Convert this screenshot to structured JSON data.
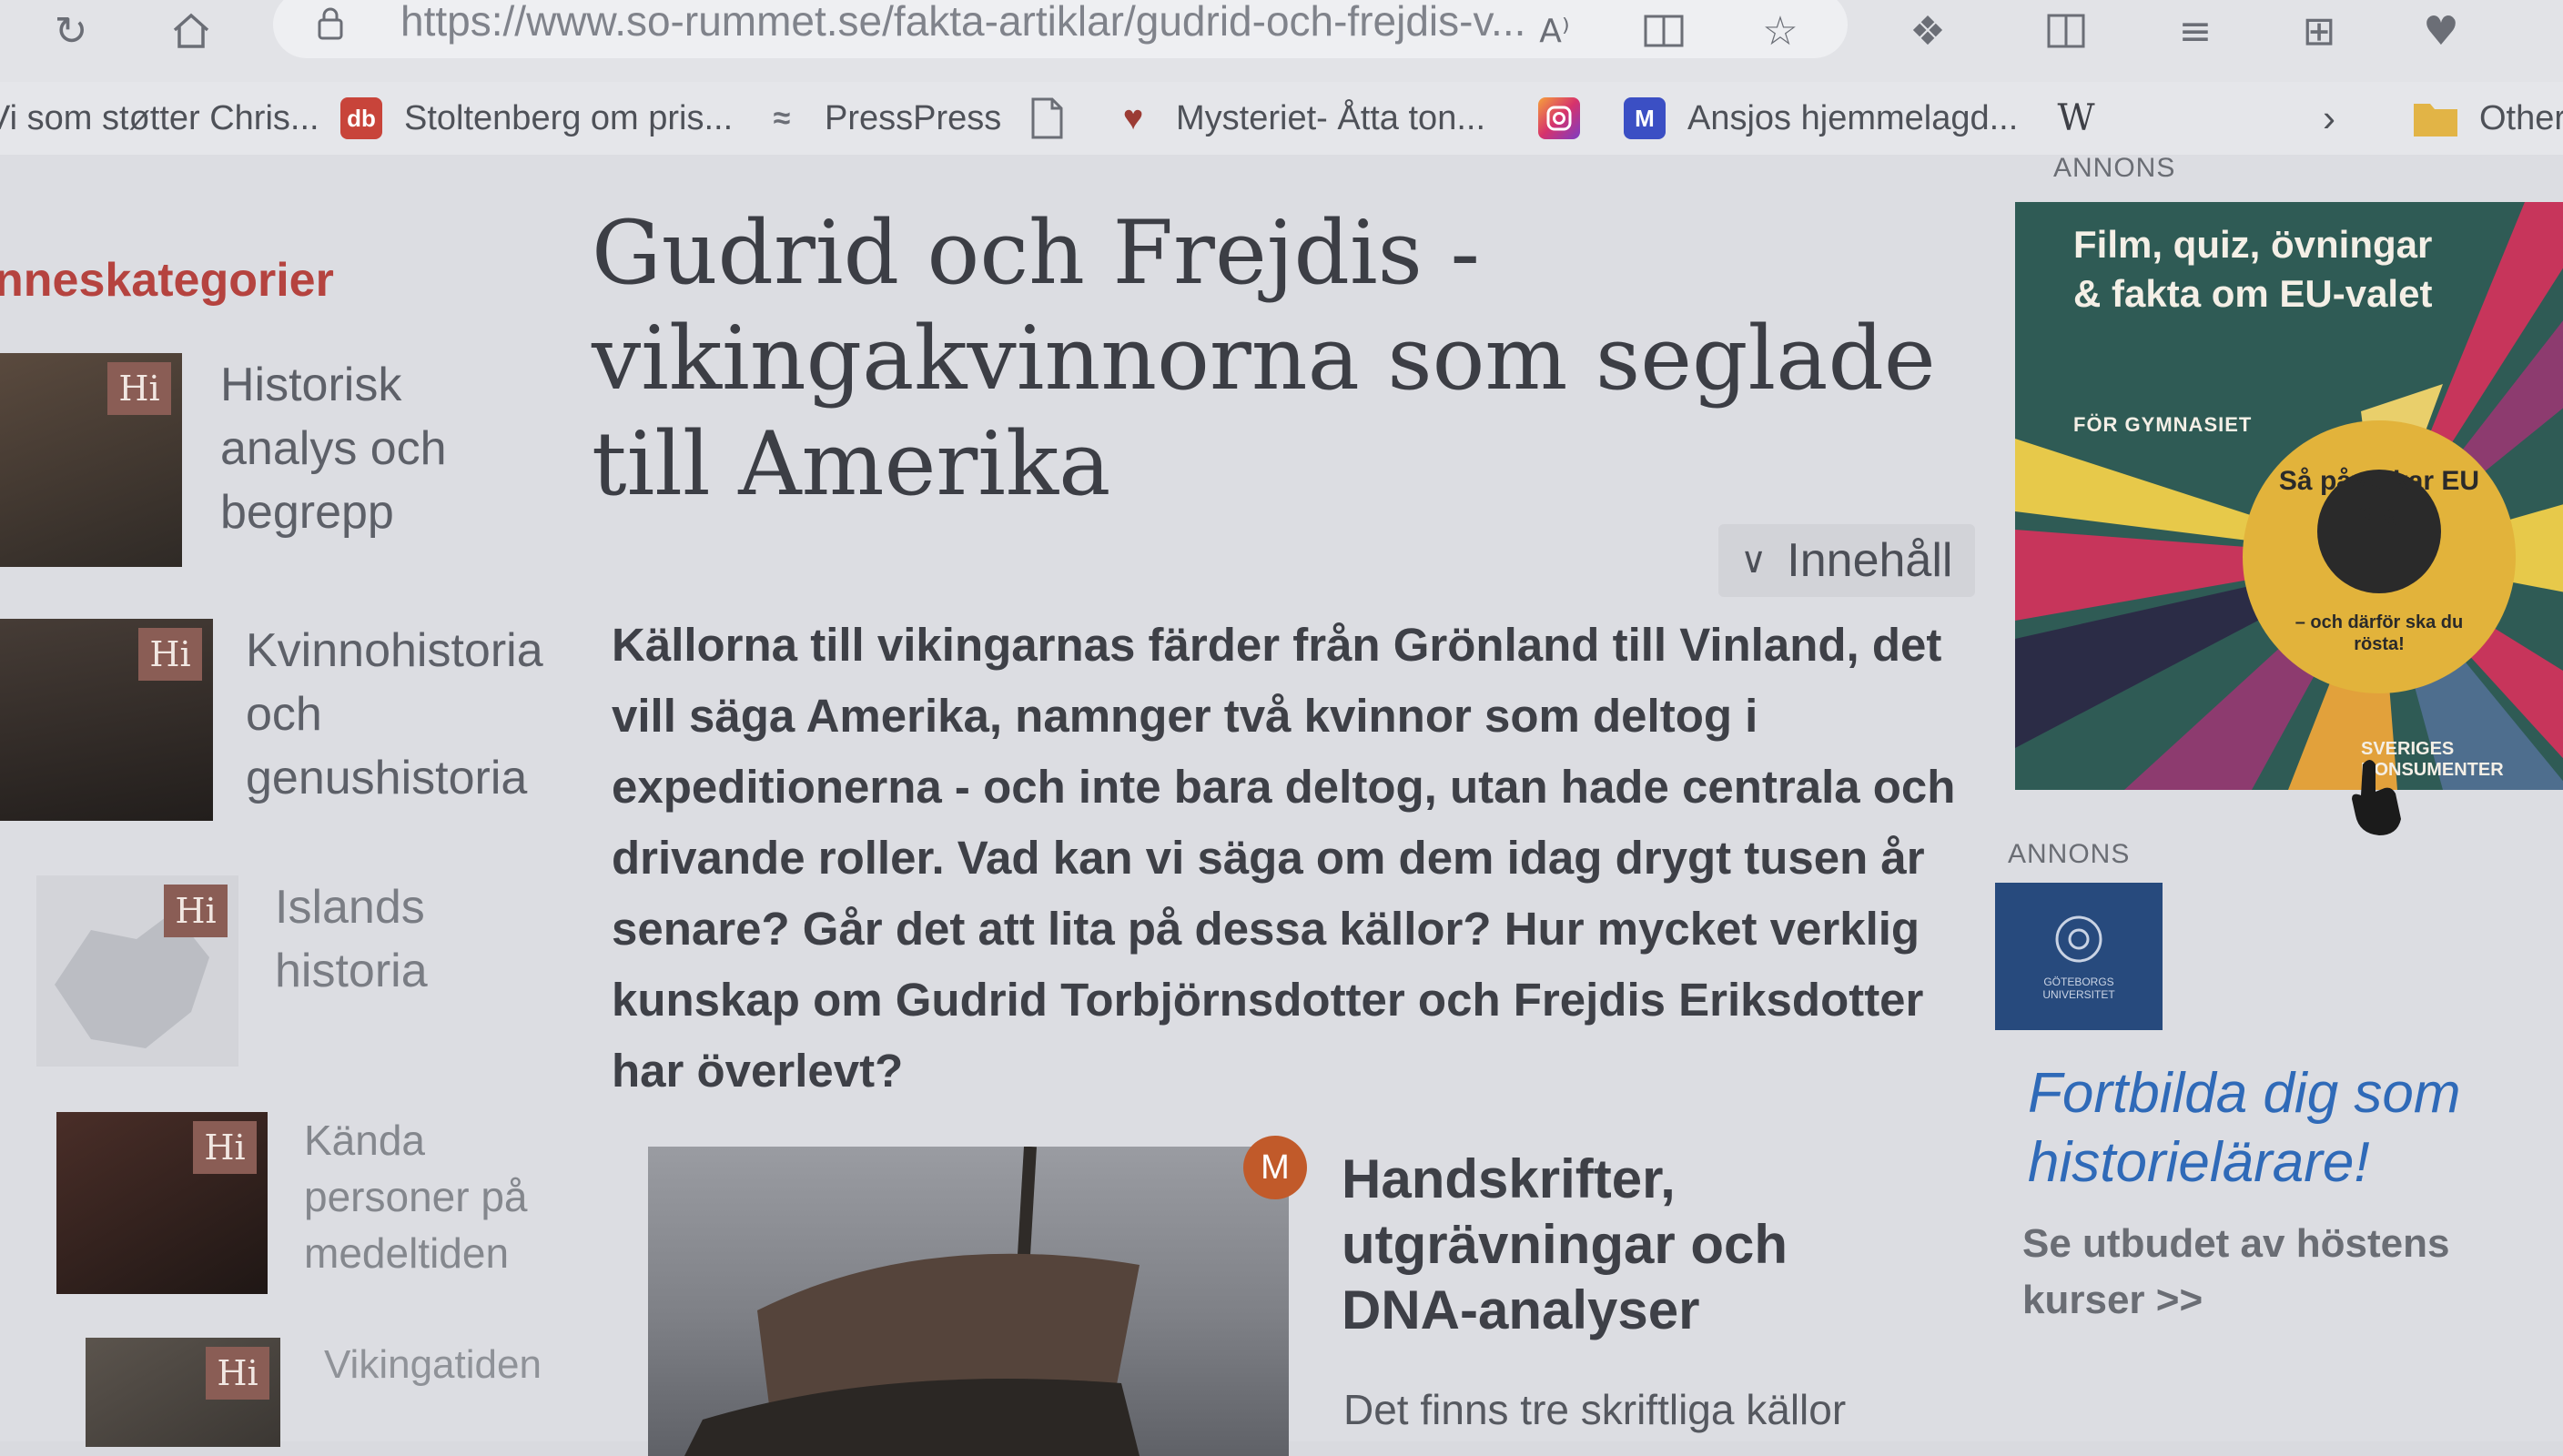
{
  "browser": {
    "url": "https://www.so-rummet.se/fakta-artiklar/gudrid-och-frejdis-v...",
    "read_aloud_label": "A⁾",
    "bookmarks": [
      {
        "label": "Vi som støtter Chris..."
      },
      {
        "label": "Stoltenberg om pris...",
        "favicon_text": "db",
        "favicon_color": "#c8443a"
      },
      {
        "label": "PressPress"
      },
      {
        "label": ""
      },
      {
        "label": "Mysteriet- Åtta ton..."
      },
      {
        "label": "",
        "favicon_color": "#d6336c"
      },
      {
        "label": "Ansjos hjemmelagd...",
        "favicon_text": "M",
        "favicon_color": "#3b4fc4"
      },
      {
        "label": "",
        "favicon_text": "W"
      }
    ],
    "other_favorites_label": "Other"
  },
  "sidebar": {
    "heading": "nneskategorier",
    "badge_text": "Hi",
    "categories": [
      {
        "label": "Historisk analys och begrepp"
      },
      {
        "label": "Kvinnohistoria och genushistoria"
      },
      {
        "label": "Islands historia"
      },
      {
        "label": "Kända personer på medeltiden"
      },
      {
        "label": "Vikingatiden"
      }
    ]
  },
  "article": {
    "title": "Gudrid och Frejdis - vikingakvinnorna som seglade till Amerika",
    "toc_label": "Innehåll",
    "lead": "Källorna till vikingarnas färder från Grönland till Vinland, det vill säga Amerika, namnger två kvinnor som deltog i expeditionerna - och inte bara deltog, utan hade centrala och drivande roller. Vad kan vi säga om dem idag drygt tusen år senare? Går det att lita på dessa källor? Hur mycket verklig kunskap om Gudrid Torbjörnsdotter och Frejdis Eriksdotter har överlevt?",
    "card": {
      "badge": "M",
      "title": "Handskrifter, utgrävningar och DNA-analyser",
      "text": "Det finns tre skriftliga källor"
    }
  },
  "ads": {
    "label_top": "ANNONS",
    "banner": {
      "text": "Film, quiz, övningar & fakta om EU-valet",
      "sub": "FÖR GYMNASIET",
      "circle_text": "Så påverkar EU dig",
      "circle_sub": "– och därför ska du rösta!",
      "brand": "SVERIGES KONSUMENTER"
    },
    "label_bottom": "ANNONS",
    "uni_logo_text": "GÖTEBORGS UNIVERSITET",
    "link": "Fortbilda dig som historielärare!",
    "more": "Se utbudet av höstens kurser >>"
  }
}
